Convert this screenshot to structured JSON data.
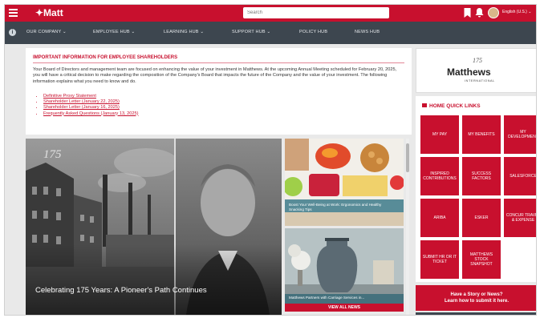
{
  "topbar": {
    "logo": "✦Matt",
    "search_placeholder": "Search",
    "language": "English (U.S.) ⌄",
    "accent": "#c8102e"
  },
  "nav": {
    "items": [
      {
        "label": "OUR COMPANY ⌄"
      },
      {
        "label": "EMPLOYEE HUB ⌄"
      },
      {
        "label": "LEARNING HUB ⌄"
      },
      {
        "label": "SUPPORT HUB ⌄"
      },
      {
        "label": "POLICY HUB"
      },
      {
        "label": "NEWS HUB"
      }
    ]
  },
  "shareholder": {
    "title": "IMPORTANT INFORMATION FOR EMPLOYEE SHAREHOLDERS",
    "body": "Your Board of Directors and management team are focused on enhancing the value of your investment in Matthews. At the upcoming Annual Meeting scheduled for February 20, 2025, you will have a critical decision to make regarding the composition of the Company's Board that impacts the future of the Company and the value of your investment. The following information explains what you need to know and do.",
    "links": [
      "Definitive Proxy Statement",
      "Shareholder Letter (January 22, 2025)",
      "Shareholder Letter (January 16, 2025)",
      "Frequently Asked Questions (January 13, 2025)"
    ]
  },
  "hero": {
    "badge": "175",
    "caption": "Celebrating 175 Years: A Pioneer's Path Continues"
  },
  "news": [
    {
      "caption": "Boost Your Well-Being at Work: Ergonomics and Healthy Snacking Tips"
    },
    {
      "caption": "Matthews Partners with Carriage Services in..."
    }
  ],
  "view_all": "VIEW ALL NEWS",
  "brand_logo": {
    "anniversary": "175",
    "name": "Matthews",
    "sub": "INTERNATIONAL"
  },
  "quick_links": {
    "title": "HOME QUICK LINKS",
    "tiles": [
      "MY PAY",
      "MY BENEFITS",
      "MY DEVELOPMENT",
      "INSPIRED CONTRIBUTIONS",
      "SUCCESS FACTORS",
      "SALESFORCE",
      "ARIBA",
      "ESKER",
      "CONCUR TRAVEL & EXPENSE",
      "SUBMIT HR OR IT TICKET",
      "MATTHEWS STOCK SNAPSHOT"
    ]
  },
  "story": {
    "line1": "Have a Story or News?",
    "line2": "Learn how to submit it here."
  }
}
